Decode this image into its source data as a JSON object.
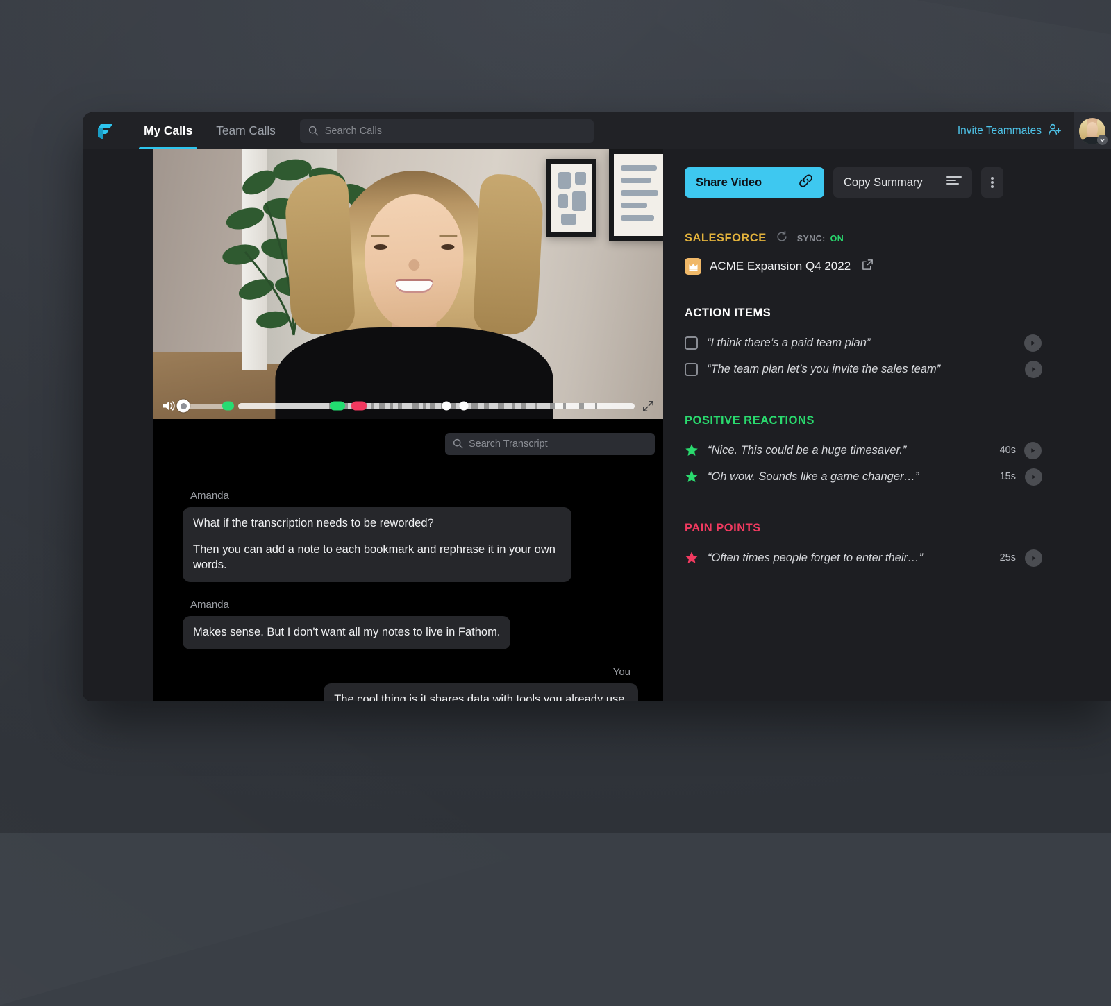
{
  "topnav": {
    "logo_icon": "fathom-logo-icon",
    "tabs": [
      {
        "label": "My Calls",
        "active": true
      },
      {
        "label": "Team Calls",
        "active": false
      }
    ],
    "search": {
      "placeholder": "Search Calls",
      "value": "",
      "icon": "search-icon"
    },
    "invite_label": "Invite Teammates",
    "invite_icon": "person-add-icon",
    "avatar_icon": "user-avatar",
    "avatar_chevron_icon": "chevron-down-icon"
  },
  "player": {
    "volume_icon": "volume-on-icon",
    "fullscreen_icon": "expand-icon",
    "volume_percent": 16,
    "progress_percent": 24,
    "markers": [
      {
        "type": "green",
        "position_percent": 25.0
      },
      {
        "type": "red",
        "position_percent": 30.5
      },
      {
        "type": "white",
        "position_percent": 52.5
      },
      {
        "type": "white",
        "position_percent": 57.0
      }
    ]
  },
  "transcript": {
    "search": {
      "placeholder": "Search Transcript",
      "value": "",
      "icon": "search-icon"
    },
    "messages": [
      {
        "speaker": "Amanda",
        "side": "left",
        "lines": [
          "What if the transcription needs to be reworded?",
          "Then you can add a note to each bookmark and rephrase it in your own words."
        ]
      },
      {
        "speaker": "Amanda",
        "side": "left",
        "lines": [
          "Makes sense.  But I don't want all my notes to live in Fathom."
        ]
      },
      {
        "speaker": "You",
        "side": "right",
        "lines": [
          "The cool thing is it shares data with tools you already use."
        ]
      }
    ]
  },
  "panel": {
    "share_button": {
      "label": "Share Video",
      "icon": "link-icon"
    },
    "copy_button": {
      "label": "Copy Summary",
      "icon": "summary-lines-icon"
    },
    "more_button": {
      "icon": "more-vertical-icon"
    },
    "salesforce": {
      "title": "SALESFORCE",
      "sync_label": "SYNC:",
      "sync_value": "ON",
      "sync_icon": "refresh-icon",
      "opportunity": "ACME Expansion Q4 2022",
      "opportunity_icon": "crown-icon",
      "external_link_icon": "external-link-icon"
    },
    "action_items": {
      "heading": "ACTION ITEMS",
      "items": [
        {
          "text": "“I think there’s a paid team plan”",
          "checked": false,
          "play_icon": "play-icon"
        },
        {
          "text": "“The team plan let’s you invite the sales team”",
          "checked": false,
          "play_icon": "play-icon"
        }
      ]
    },
    "positive_reactions": {
      "heading": "POSITIVE REACTIONS",
      "items": [
        {
          "text": "“Nice.  This could be a huge timesaver.”",
          "time": "40s",
          "icon": "star-icon",
          "play_icon": "play-icon"
        },
        {
          "text": "“Oh wow.  Sounds like a game changer…”",
          "time": "15s",
          "icon": "star-icon",
          "play_icon": "play-icon"
        }
      ]
    },
    "pain_points": {
      "heading": "PAIN POINTS",
      "items": [
        {
          "text": "“Often times people forget to enter their…”",
          "time": "25s",
          "icon": "star-icon",
          "play_icon": "play-icon"
        }
      ]
    }
  },
  "colors": {
    "accent_cyan": "#3ec8f0",
    "salesforce_gold": "#e2b23c",
    "positive_green": "#2ada6e",
    "pain_pink": "#f23a60",
    "panel_bg": "#1d1e22",
    "transcript_bg": "#000000"
  }
}
